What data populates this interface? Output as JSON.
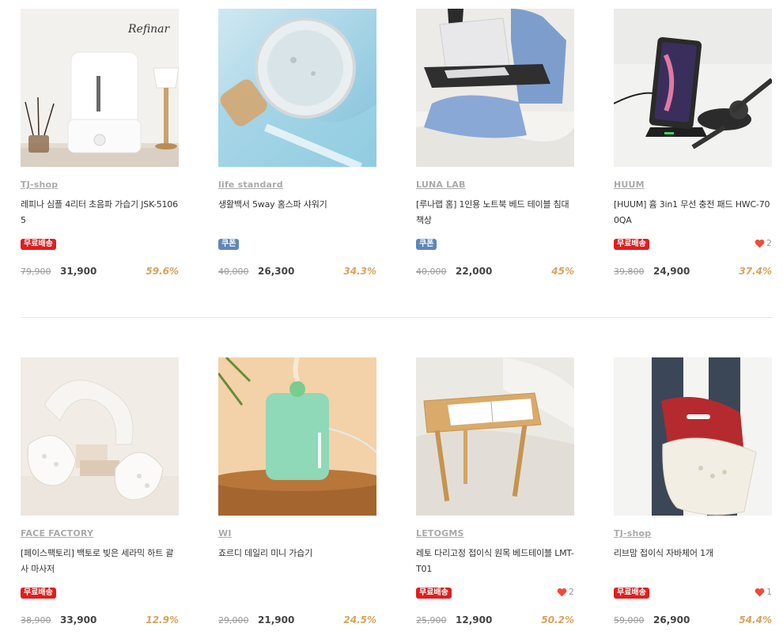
{
  "colors": {
    "free_shipping_badge": "#e01e1e",
    "coupon_badge": "#5f86b8",
    "discount": "#d9a25d",
    "heart": "#f04a3a",
    "brand": "#aaaaaa"
  },
  "products": [
    {
      "brand": "TJ-shop",
      "title": "레피나 심플 4리터 초음파 가습기 JSK-51065",
      "badge": "무료배송",
      "badge_type": "free",
      "likes": "",
      "original_price": "79,900",
      "price": "31,900",
      "discount": "59.6%",
      "image": "white-humidifier-image"
    },
    {
      "brand": "life standard",
      "title": "생활백서 5way 홈스파 샤워기",
      "badge": "쿠폰",
      "badge_type": "coupon",
      "likes": "",
      "original_price": "40,000",
      "price": "26,300",
      "discount": "34.3%",
      "image": "shower-head-image"
    },
    {
      "brand": "LUNA LAB",
      "title": "[루나랩 홈] 1인용 노트북 베드 테이블 침대 책상",
      "badge": "쿠폰",
      "badge_type": "coupon",
      "likes": "",
      "original_price": "40,000",
      "price": "22,000",
      "discount": "45%",
      "image": "laptop-bed-table-image"
    },
    {
      "brand": "HUUM",
      "title": "[HUUM] 흄 3in1 무선 충전 패드 HWC-700QA",
      "badge": "무료배송",
      "badge_type": "free",
      "likes": "2",
      "original_price": "39,800",
      "price": "24,900",
      "discount": "37.4%",
      "image": "wireless-charger-image"
    },
    {
      "brand": "FACE FACTORY",
      "title": "[페이스팩토리] 백토로 빚은 세라믹 하트 괄사 마사저",
      "badge": "무료배송",
      "badge_type": "free",
      "likes": "",
      "original_price": "38,900",
      "price": "33,900",
      "discount": "12.9%",
      "image": "ceramic-massager-image"
    },
    {
      "brand": "WI",
      "title": "죠르디 데일리 미니 가습기",
      "badge": "",
      "badge_type": "",
      "likes": "",
      "original_price": "29,000",
      "price": "21,900",
      "discount": "24.5%",
      "image": "mint-humidifier-image"
    },
    {
      "brand": "LETOGMS",
      "title": "레토 다리고정 접이식 원목 베드테이블 LMT-T01",
      "badge": "무료배송",
      "badge_type": "free",
      "likes": "2",
      "original_price": "25,900",
      "price": "12,900",
      "discount": "50.2%",
      "image": "wooden-bed-table-image"
    },
    {
      "brand": "TJ-shop",
      "title": "리브맘 접이식 자바체어 1개",
      "badge": "무료배송",
      "badge_type": "free",
      "likes": "1",
      "original_price": "59,000",
      "price": "26,900",
      "discount": "54.4%",
      "image": "posture-chair-image"
    }
  ],
  "image_text": {
    "refinar_logo": "Refinar"
  }
}
